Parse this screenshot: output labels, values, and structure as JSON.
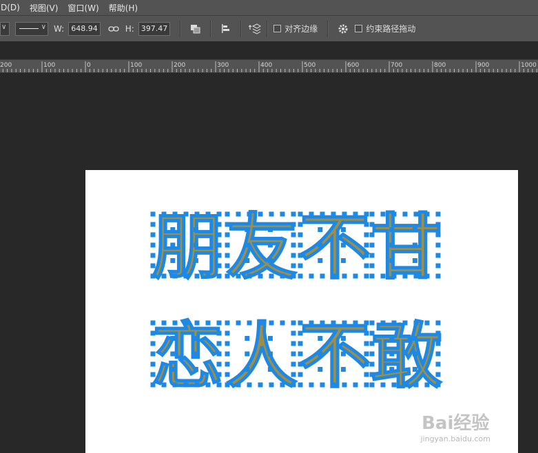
{
  "menu": {
    "items": [
      "D(D)",
      "视图(V)",
      "窗口(W)",
      "帮助(H)"
    ]
  },
  "options": {
    "w_label": "W:",
    "w_value": "648.94",
    "h_label": "H:",
    "h_value": "397.47",
    "align_edges_label": "对齐边缘",
    "constrain_path_label": "约束路径拖动"
  },
  "ruler": {
    "ticks": [
      "200",
      "100",
      "0",
      "100",
      "200",
      "300",
      "400",
      "500",
      "600",
      "700",
      "800",
      "900",
      "1000"
    ]
  },
  "canvas": {
    "line1": [
      "朋",
      "友",
      "不",
      "甘"
    ],
    "line2": [
      "恋",
      "人",
      "不",
      "敢"
    ],
    "glyph_fill": "#9c8f4a",
    "anchor_color": "#1e88e5",
    "background": "#282828",
    "document_color": "#ffffff"
  },
  "watermark": {
    "brand": "Bai经验",
    "url": "jingyan.baidu.com"
  }
}
